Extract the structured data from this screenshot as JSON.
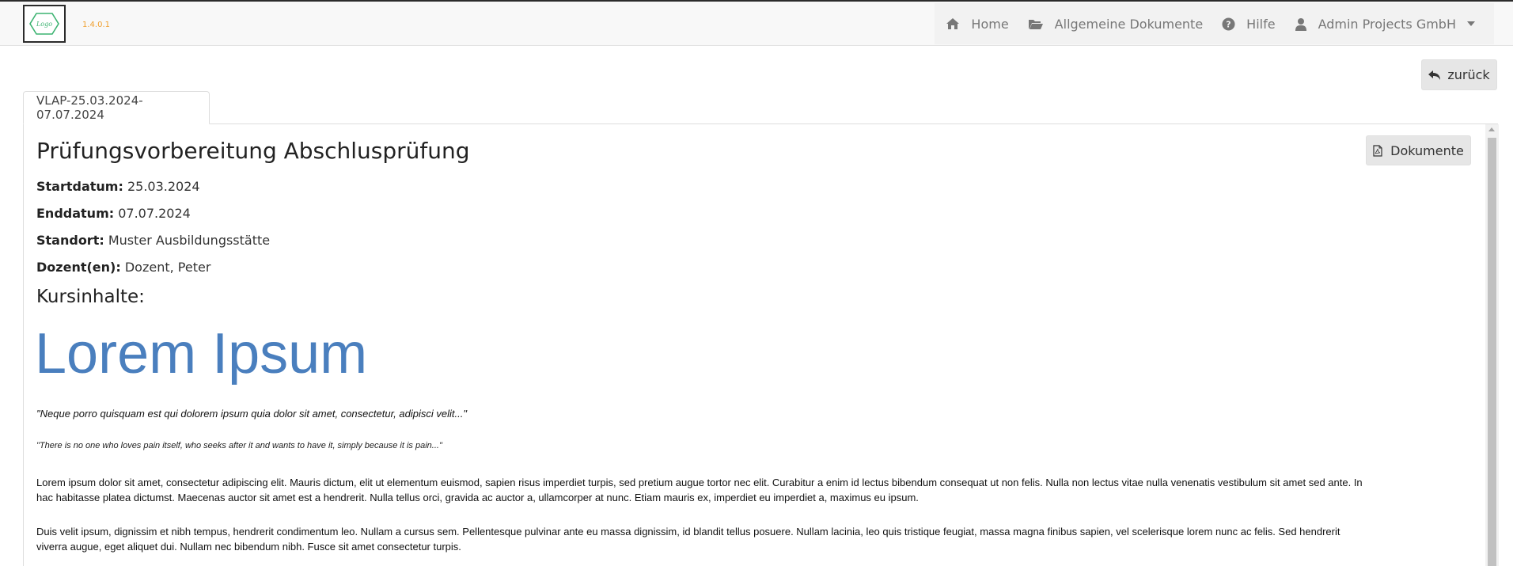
{
  "app": {
    "version": "1.4.0.1",
    "logo_text": "Logo"
  },
  "nav": {
    "items": [
      {
        "label": "Home",
        "icon": "home-icon"
      },
      {
        "label": "Allgemeine Dokumente",
        "icon": "folder-open-icon"
      },
      {
        "label": "Hilfe",
        "icon": "question-circle-icon"
      },
      {
        "label": "Admin Projects GmbH",
        "icon": "user-icon"
      }
    ]
  },
  "actions": {
    "back_label": "zurück",
    "documents_label": "Dokumente"
  },
  "tabs": [
    {
      "label": "VLAP-25.03.2024-07.07.2024",
      "active": true
    }
  ],
  "course": {
    "title": "Prüfungsvorbereitung Abschlusprüfung",
    "fields": [
      {
        "label": "Startdatum:",
        "value": "25.03.2024"
      },
      {
        "label": "Enddatum:",
        "value": "07.07.2024"
      },
      {
        "label": "Standort:",
        "value": "Muster Ausbildungsstätte"
      },
      {
        "label": "Dozent(en):",
        "value": "Dozent, Peter"
      }
    ],
    "contents_heading": "Kursinhalte:"
  },
  "content": {
    "heading": "Lorem Ipsum",
    "quote1": "\"Neque porro quisquam est qui dolorem ipsum quia dolor sit amet, consectetur, adipisci velit...\"",
    "quote2": "\"There is no one who loves pain itself, who seeks after it and wants to have it, simply because it is pain...\"",
    "paragraphs": [
      "Lorem ipsum dolor sit amet, consectetur adipiscing elit. Mauris dictum, elit ut elementum euismod, sapien risus imperdiet turpis, sed pretium augue tortor nec elit. Curabitur a enim id lectus bibendum consequat ut non felis. Nulla non lectus vitae nulla venenatis vestibulum sit amet sed ante. In hac habitasse platea dictumst. Maecenas auctor sit amet est a hendrerit. Nulla tellus orci, gravida ac auctor a, ullamcorper at nunc. Etiam mauris ex, imperdiet eu imperdiet a, maximus eu ipsum.",
      "Duis velit ipsum, dignissim et nibh tempus, hendrerit condimentum leo. Nullam a cursus sem. Pellentesque pulvinar ante eu massa dignissim, id blandit tellus posuere. Nullam lacinia, leo quis tristique feugiat, massa magna finibus sapien, vel scelerisque lorem nunc ac felis. Sed hendrerit viverra augue, eget aliquet dui. Nullam nec bibendum nibh. Fusce sit amet consectetur turpis."
    ]
  },
  "colors": {
    "accent_blue": "#4a7fbe",
    "version_orange": "#f0a030",
    "logo_green": "#3cb371",
    "nav_text": "#777777"
  }
}
